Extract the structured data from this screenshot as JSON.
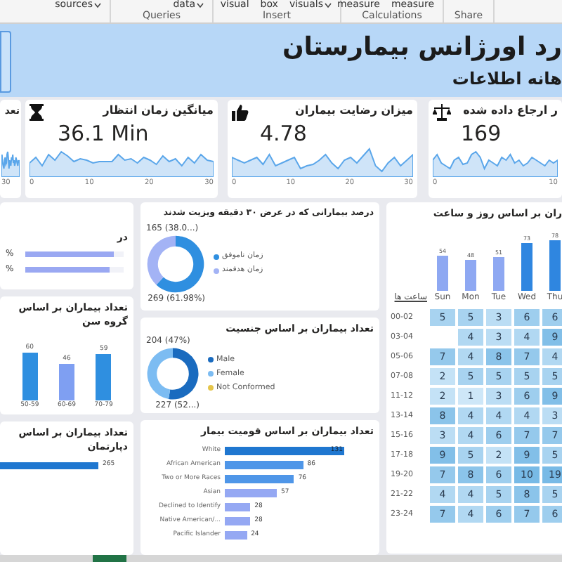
{
  "ribbon": {
    "groups": [
      {
        "buttons": [
          {
            "label": "sources",
            "menu": true
          }
        ]
      },
      {
        "label": "Queries",
        "buttons": [
          {
            "label": "data",
            "menu": true
          }
        ]
      },
      {
        "label": "Insert",
        "buttons": [
          {
            "label": "visual",
            "menu": false
          },
          {
            "label": "box",
            "menu": false
          },
          {
            "label": "visuals",
            "menu": true
          }
        ]
      },
      {
        "label": "Calculations",
        "buttons": [
          {
            "label": "measure",
            "menu": false
          },
          {
            "label": "measure",
            "menu": false
          }
        ]
      },
      {
        "label": "Share"
      }
    ]
  },
  "header": {
    "title": "رد اورژانس بیمارستان",
    "subtitle": "هانه اطلاعات"
  },
  "cut_off_kpi": {
    "kind": "partial",
    "title": "تعد",
    "ticks": [
      "30"
    ]
  },
  "right_kpi": {
    "kind": "scale",
    "title": "ر ارجاع داده شده",
    "value": "169",
    "ticks": [
      "0",
      "10"
    ]
  },
  "middle_kpi": {
    "kind": "thumbs",
    "title": "میزان رضایت بیماران",
    "value": "4.78",
    "ticks": [
      "0",
      "10",
      "20",
      "30"
    ]
  },
  "left_kpi": {
    "kind": "hourglass",
    "title": "میانگین زمان انتظار",
    "value": "36.1 Min",
    "ticks": [
      "0",
      "10",
      "20",
      "30"
    ]
  },
  "share_card": {
    "title": "در",
    "bars": [
      {
        "label": "%",
        "level": 0.9
      },
      {
        "label": "%",
        "level": 0.85
      }
    ]
  },
  "age_card": {
    "chart_data": {
      "type": "bar",
      "title": "تعداد بیماران بر اساس گروه سن",
      "categories": [
        "50-59",
        "60-69",
        "70-79"
      ],
      "values": [
        60,
        46,
        59
      ],
      "data_labels": true
    }
  },
  "dept_card": {
    "title": "تعداد بیماران بر اساس دپارتمان",
    "bar_label": "265"
  },
  "visit_card": {
    "chart_data": {
      "type": "donut",
      "title": "درصد بیمارانی که در عرض ۳۰ دقیقه ویزیت شدند",
      "categories": [
        "زمان ناموفق",
        "زمان هدفمند"
      ],
      "values": [
        269,
        165
      ],
      "colors": [
        "#2f8fe0",
        "#a3b3f5"
      ],
      "legend": "right",
      "value_labels": [
        "269 (61.98%)",
        "165 (38.0...)"
      ]
    }
  },
  "gender_card": {
    "chart_data": {
      "type": "donut",
      "title": "تعداد بیماران بر اساس جنسیت",
      "categories": [
        "Male",
        "Female",
        "Not Conformed"
      ],
      "values": [
        227,
        204,
        0
      ],
      "colors": [
        "#1a6bbf",
        "#7cbcf2",
        "#e5c54a"
      ],
      "legend": "right",
      "value_labels": [
        "227 (52...)",
        "204 (47%)",
        null
      ]
    }
  },
  "race_card": {
    "chart_data": {
      "type": "bar",
      "orientation": "horizontal",
      "title": "تعداد بیماران بر اساس قومیت بیمار",
      "categories": [
        "White",
        "African American",
        "Two or More Races",
        "Asian",
        "Declined to Identify",
        "Native American/...",
        "Pacific Islander"
      ],
      "values": [
        131,
        86,
        76,
        57,
        28,
        28,
        24
      ],
      "data_labels": true
    }
  },
  "schedule_card": {
    "chart_data": {
      "type": "bar",
      "title": "ران بر اساس روز و ساعت",
      "categories": [
        "Sun",
        "Mon",
        "Tue",
        "Wed",
        "Thu"
      ],
      "values": [
        54,
        48,
        51,
        73,
        78
      ],
      "data_labels": true
    },
    "hours_header": "ساعت ها",
    "rows": [
      {
        "hours": "00-02",
        "cells": [
          "5",
          "5",
          "3",
          "6",
          "6"
        ]
      },
      {
        "hours": "03-04",
        "cells": [
          "",
          "4",
          "3",
          "4",
          "9"
        ]
      },
      {
        "hours": "05-06",
        "cells": [
          "7",
          "4",
          "8",
          "7",
          "4"
        ]
      },
      {
        "hours": "07-08",
        "cells": [
          "2",
          "5",
          "5",
          "5",
          "5"
        ]
      },
      {
        "hours": "11-12",
        "cells": [
          "2",
          "1",
          "3",
          "6",
          "9"
        ]
      },
      {
        "hours": "13-14",
        "cells": [
          "8",
          "4",
          "4",
          "4",
          "3"
        ]
      },
      {
        "hours": "15-16",
        "cells": [
          "3",
          "4",
          "6",
          "7",
          "7"
        ]
      },
      {
        "hours": "17-18",
        "cells": [
          "9",
          "5",
          "2",
          "9",
          "5"
        ]
      },
      {
        "hours": "19-20",
        "cells": [
          "7",
          "8",
          "6",
          "10",
          "19"
        ]
      },
      {
        "hours": "21-22",
        "cells": [
          "4",
          "4",
          "5",
          "8",
          "5"
        ]
      },
      {
        "hours": "23-24",
        "cells": [
          "7",
          "4",
          "6",
          "7",
          "6"
        ]
      }
    ]
  }
}
